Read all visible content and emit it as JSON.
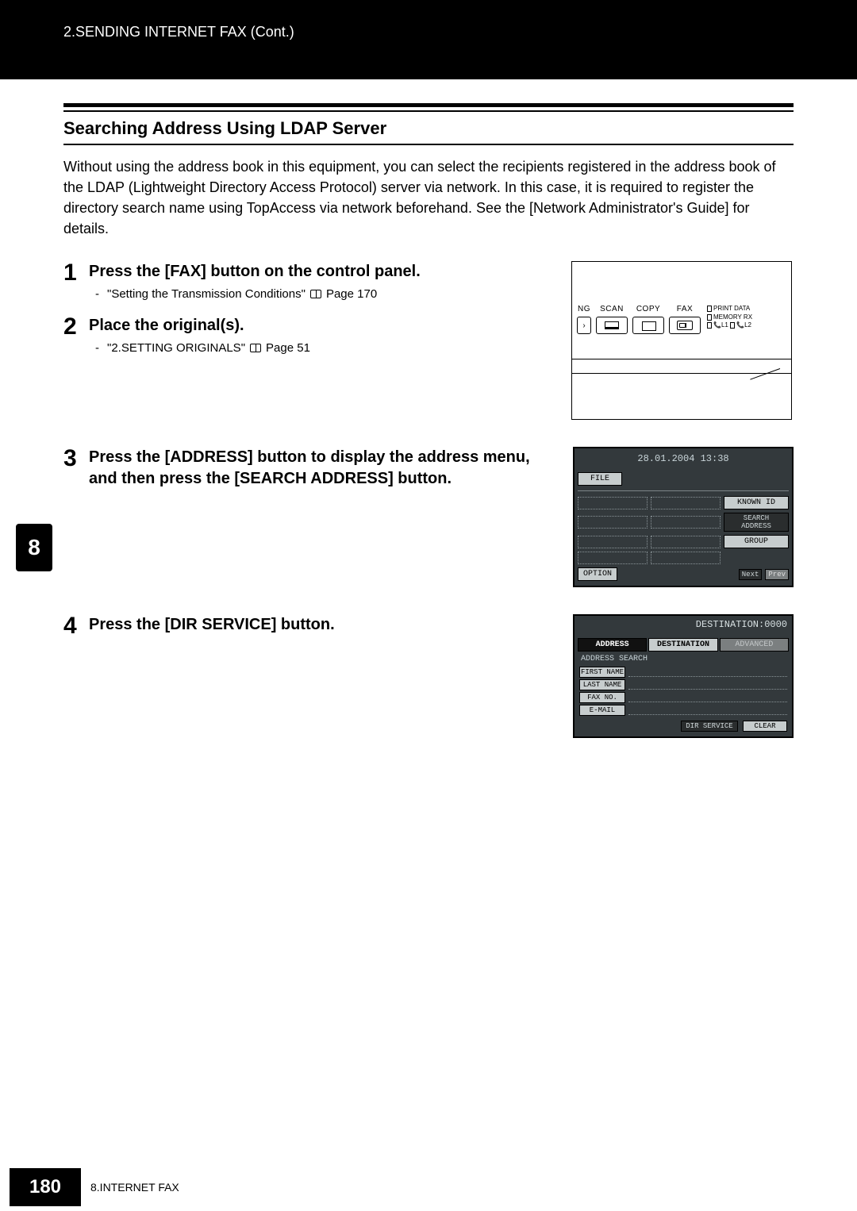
{
  "header": {
    "breadcrumb": "2.SENDING INTERNET FAX (Cont.)"
  },
  "section": {
    "title": "Searching Address Using LDAP Server",
    "intro": "Without using the address book in this equipment, you can select the recipients registered in the address book of the LDAP (Lightweight Directory Access Protocol) server via network. In this case, it is required to register the directory search name using TopAccess via network beforehand. See the [Network Administrator's Guide] for details."
  },
  "side_tab": "8",
  "steps": [
    {
      "num": "1",
      "text": "Press the [FAX] button on the control panel.",
      "sub": [
        {
          "label": "\"Setting the Transmission Conditions\"",
          "page": "Page 170"
        }
      ]
    },
    {
      "num": "2",
      "text": "Place the original(s).",
      "sub": [
        {
          "label": "\"2.SETTING ORIGINALS\"",
          "page": "Page 51"
        }
      ]
    },
    {
      "num": "3",
      "text": "Press the [ADDRESS] button to display the address menu, and then press the [SEARCH ADDRESS] button."
    },
    {
      "num": "4",
      "text": "Press the [DIR SERVICE] button."
    }
  ],
  "panel": {
    "modes": {
      "ng": "NG",
      "scan": "SCAN",
      "copy": "COPY",
      "fax": "FAX"
    },
    "leds": {
      "print": "PRINT DATA",
      "memory": "MEMORY RX",
      "l1": "L1",
      "l2": "L2"
    }
  },
  "lcd1": {
    "datetime": "28.01.2004 13:38",
    "file": "FILE",
    "known_id": "KNOWN ID",
    "search_address": "SEARCH ADDRESS",
    "group": "GROUP",
    "option": "OPTION",
    "next": "Next",
    "prev": "Prev"
  },
  "lcd2": {
    "destination": "DESTINATION:0000",
    "tabs": {
      "address": "ADDRESS",
      "destination": "DESTINATION",
      "advanced": "ADVANCED"
    },
    "search_title": "ADDRESS SEARCH",
    "fields": {
      "first": "FIRST NAME",
      "last": "LAST NAME",
      "fax": "FAX NO.",
      "email": "E-MAIL"
    },
    "dir_service": "DIR SERVICE",
    "clear": "CLEAR"
  },
  "footer": {
    "page": "180",
    "chapter": "8.INTERNET FAX"
  }
}
